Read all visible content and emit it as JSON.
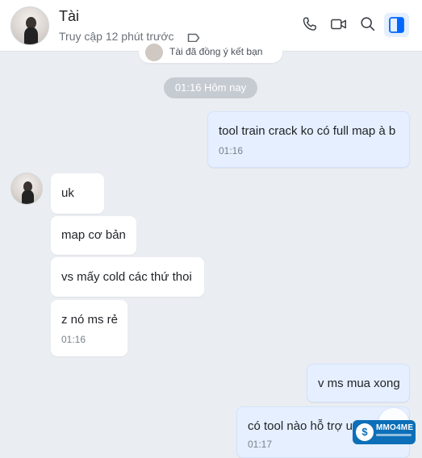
{
  "header": {
    "name": "Tài",
    "status": "Truy cập 12 phút trước",
    "icons": [
      "phone-icon",
      "video-call-icon",
      "search-icon",
      "side-panel-icon"
    ]
  },
  "system_notice": "Tài đã đồng ý kết bạn",
  "date_divider": "01:16 Hôm nay",
  "messages": [
    {
      "dir": "out",
      "text": "tool train crack ko có full map à b",
      "time": "01:16"
    },
    {
      "dir": "in",
      "text": "uk"
    },
    {
      "dir": "in",
      "text": "map cơ bản"
    },
    {
      "dir": "in",
      "text": "vs mấy cold các thứ thoi"
    },
    {
      "dir": "in",
      "text": "z nó ms rẻ",
      "time": "01:16"
    },
    {
      "dir": "out",
      "text": "v ms mua xong"
    },
    {
      "dir": "out",
      "text": "có tool nào hỗ trợ up",
      "time": "01:17"
    }
  ],
  "watermark": {
    "symbol": "$",
    "text": "MMO4ME"
  },
  "colors": {
    "background": "#eaedf1",
    "outgoing_bubble": "#e5efff",
    "incoming_bubble": "#ffffff",
    "accent": "#0068ff"
  }
}
